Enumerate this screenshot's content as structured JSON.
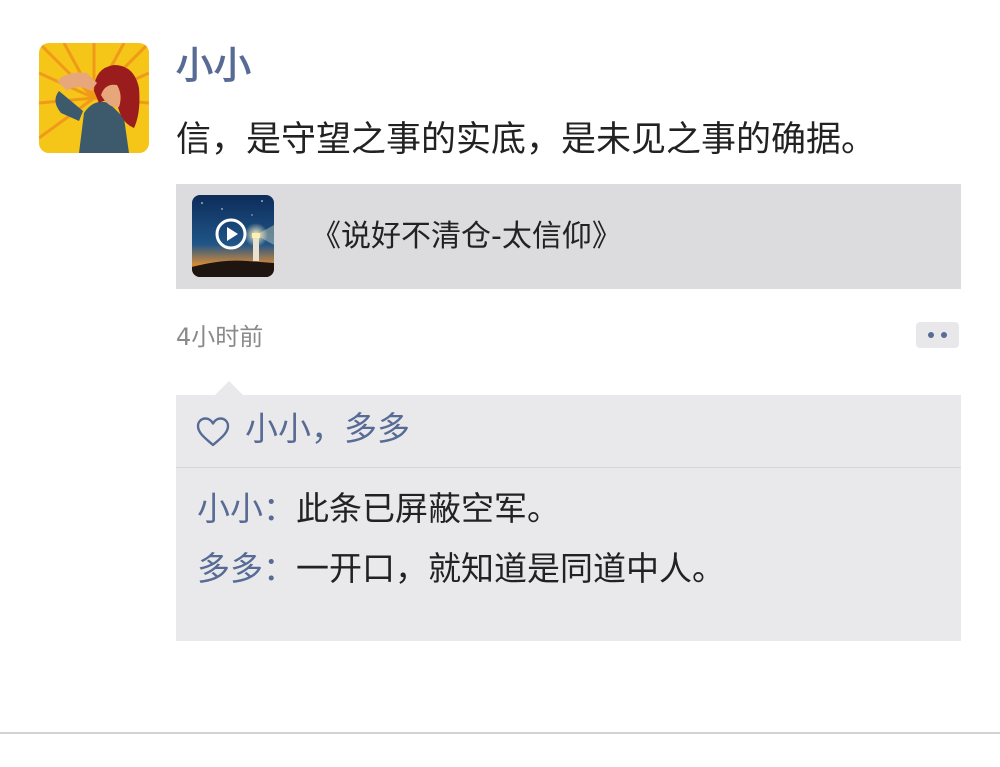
{
  "post": {
    "username": "小小",
    "text": "信，是守望之事的实底，是未见之事的确据。",
    "link": {
      "title": "《说好不清仓-太信仰》",
      "thumbnail_icon": "lighthouse-night-thumbnail",
      "play_icon": "play-circle-icon"
    },
    "timestamp": "4小时前",
    "more_icon": "more-dots-icon"
  },
  "likes": {
    "icon": "heart-outline-icon",
    "names": "小小，多多"
  },
  "comments": [
    {
      "author": "小小",
      "separator": "：",
      "text": "此条已屏蔽空军。"
    },
    {
      "author": "多多",
      "separator": "：",
      "text": "一开口，就知道是同道中人。"
    }
  ],
  "colors": {
    "link_blue": "#576b95",
    "text": "#222222",
    "timestamp": "#8a8a8a",
    "card_bg": "#dcdbdd",
    "comment_bg": "#e9e9eb"
  }
}
